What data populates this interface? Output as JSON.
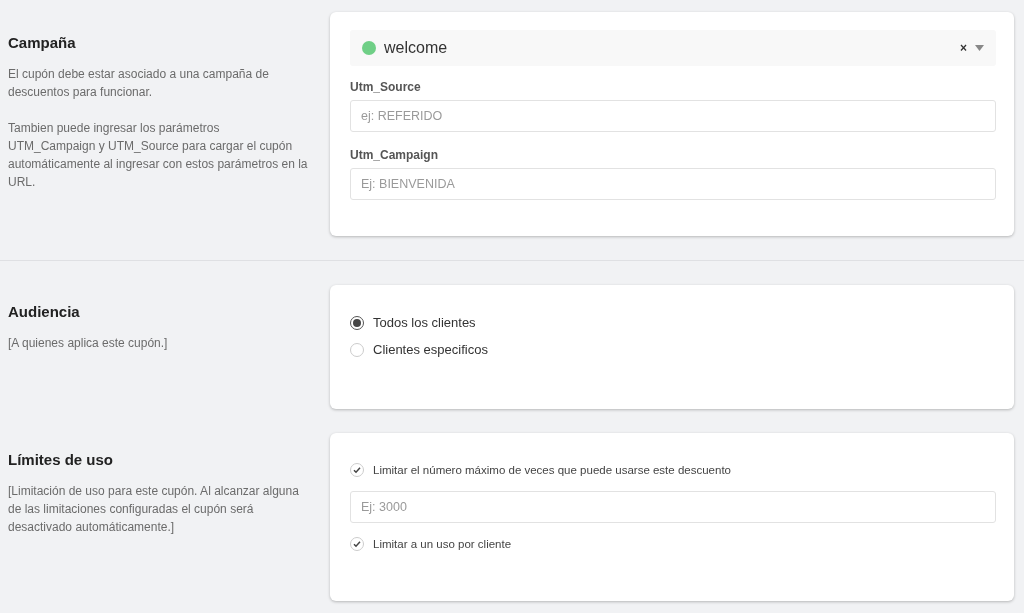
{
  "sections": [
    {
      "kind": "campaign",
      "title": "Campaña",
      "description": [
        "El cupón debe estar asociado a una campaña de descuentos para funcionar.",
        "Tambien puede ingresar los parámetros UTM_Campaign y UTM_Source para cargar el cupón automáticamente al ingresar con estos parámetros en la URL."
      ],
      "select": {
        "value": "welcome",
        "color": "#6fcf86",
        "clear": "×"
      },
      "fields": [
        {
          "label": "Utm_Source",
          "placeholder": "ej: REFERIDO"
        },
        {
          "label": "Utm_Campaign",
          "placeholder": "Ej: BIENVENIDA"
        }
      ],
      "divider_after": true
    },
    {
      "kind": "audience",
      "title": "Audiencia",
      "description": [
        "[A quienes aplica este cupón.]"
      ],
      "options": [
        {
          "label": "Todos los clientes",
          "selected": true
        },
        {
          "label": "Clientes especificos",
          "selected": false
        }
      ],
      "divider_after": false
    },
    {
      "kind": "limits",
      "title": "Límites de uso",
      "description": [
        "[Limitación de uso para este cupón. Al alcanzar alguna de las limitaciones configuradas el cupón será desactivado automáticamente.]"
      ],
      "items": [
        {
          "kind": "checkbox",
          "label": "Limitar el número máximo de veces que puede usarse este descuento",
          "checked": true
        },
        {
          "kind": "input",
          "placeholder": "Ej: 3000"
        },
        {
          "kind": "checkbox",
          "label": "Limitar a un uso por cliente",
          "checked": true
        }
      ],
      "divider_after": false
    }
  ]
}
